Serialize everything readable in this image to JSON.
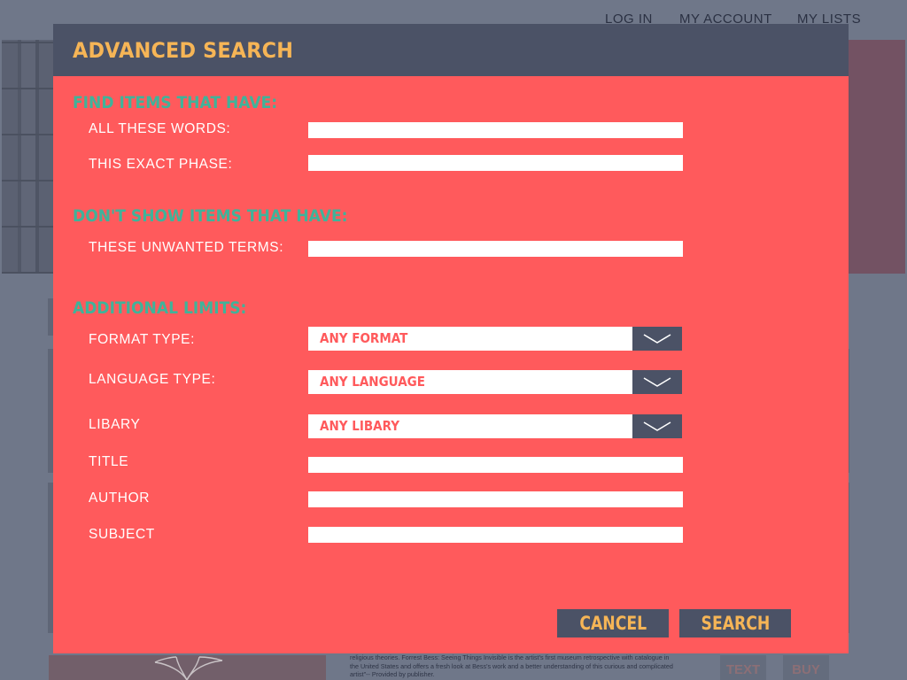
{
  "background": {
    "nav": {
      "login": "LOG IN",
      "account": "MY ACCOUNT",
      "lists": "MY LISTS"
    },
    "description": "religious theories. Forrest Bess: Seeing Things Invisible is the artist's first museum retrospective with catalogue in the United States and offers a fresh look at Bess's work and a better understanding of this curious and complicated artist\"-- Provided by publisher.",
    "buttons": {
      "text": "TEXT",
      "buy": "BUY"
    }
  },
  "modal": {
    "title": "ADVANCED SEARCH",
    "sections": {
      "find": "FIND ITEMS THAT HAVE:",
      "exclude": "DON'T SHOW ITEMS THAT HAVE:",
      "limits": "ADDITIONAL LIMITS:"
    },
    "fields": {
      "all_words": {
        "label": "ALL THESE WORDS:",
        "value": ""
      },
      "exact_phrase": {
        "label": "THIS EXACT PHASE:",
        "value": ""
      },
      "unwanted": {
        "label": "THESE UNWANTED TERMS:",
        "value": ""
      },
      "format": {
        "label": "FORMAT TYPE:",
        "selected": "ANY FORMAT"
      },
      "language": {
        "label": "LANGUAGE TYPE:",
        "selected": "ANY LANGUAGE"
      },
      "library": {
        "label": "LIBARY",
        "selected": "ANY LIBARY"
      },
      "title": {
        "label": "TITLE",
        "value": ""
      },
      "author": {
        "label": "AUTHOR",
        "value": ""
      },
      "subject": {
        "label": "SUBJECT",
        "value": ""
      }
    },
    "buttons": {
      "cancel": "CANCEL",
      "search": "SEARCH"
    }
  },
  "colors": {
    "modal_bg": "#ff5a5c",
    "header_bg": "#4b5266",
    "title_text": "#f6b556",
    "section_heading": "#3fb39a",
    "page_overlay": "#6f7789"
  },
  "icons": {
    "dropdown": "chevron-down-icon"
  }
}
